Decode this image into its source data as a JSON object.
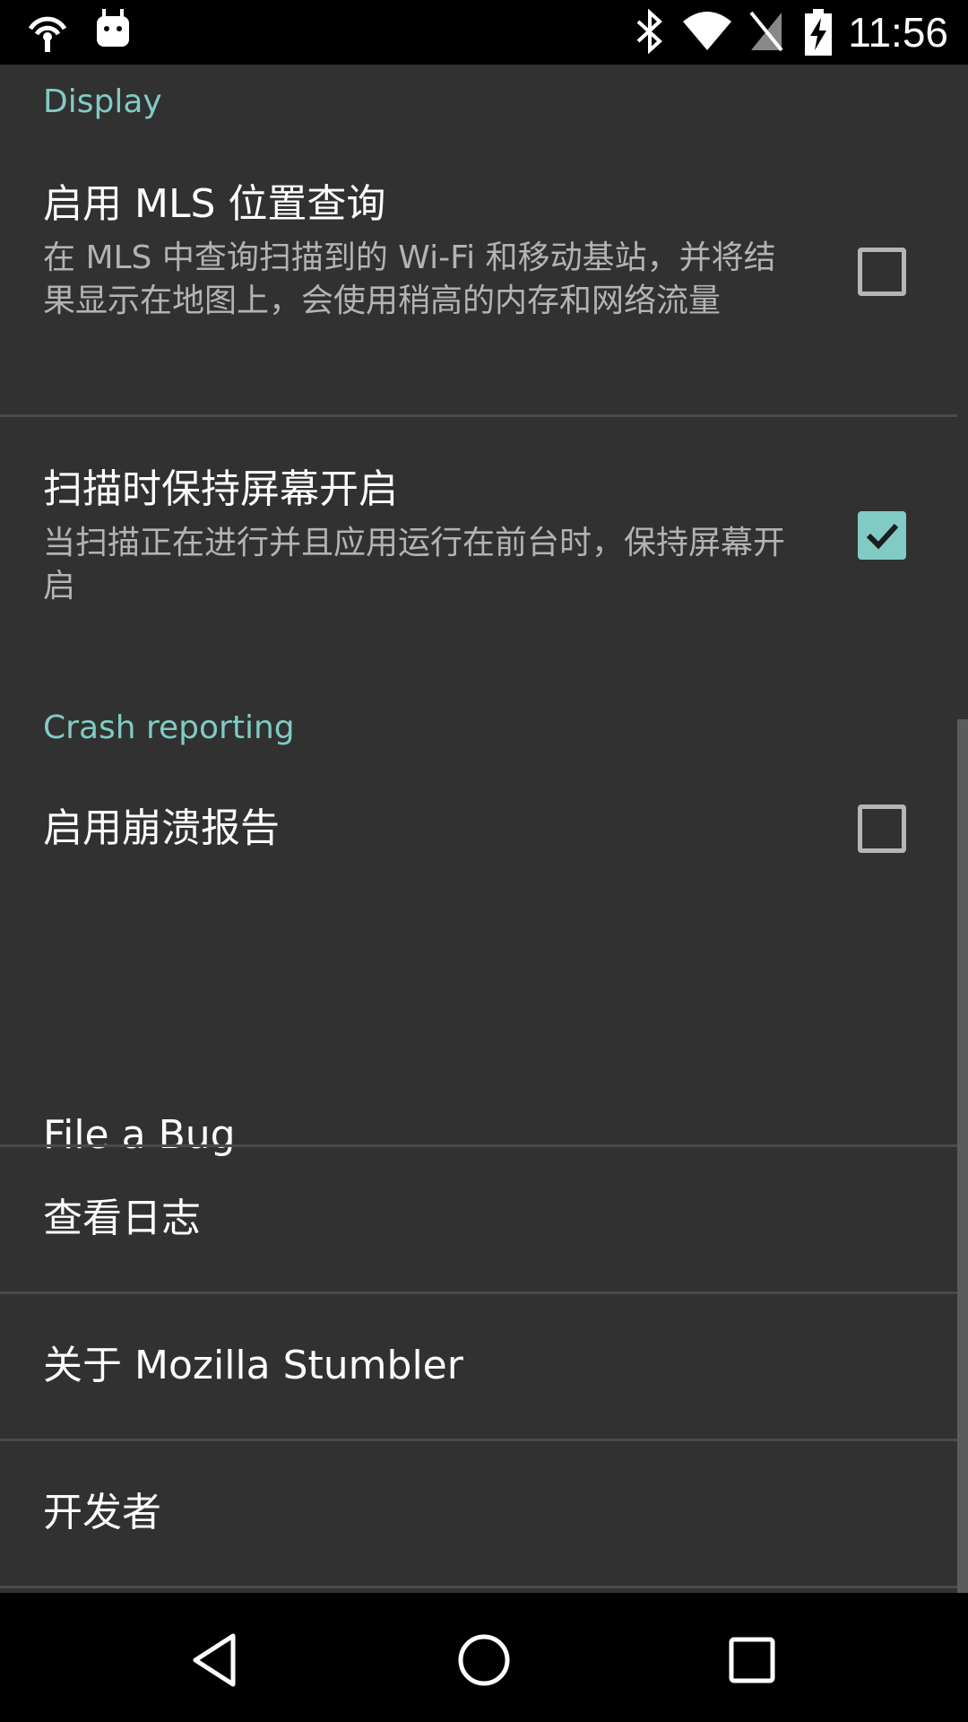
{
  "status_bar": {
    "time": "11:56",
    "left_icons": [
      "wifi-hotspot-icon",
      "android-icon"
    ],
    "right_icons": [
      "bluetooth-icon",
      "wifi-icon",
      "no-sim-icon",
      "battery-charging-icon"
    ]
  },
  "settings": {
    "display_category": "Display",
    "mls_lookup": {
      "title": "启用 MLS 位置查询",
      "summary": "在 MLS 中查询扫描到的 Wi-Fi 和移动基站，并将结果显示在地图上，会使用稍高的内存和网络流量",
      "checked": false
    },
    "keep_screen_on": {
      "title": "扫描时保持屏幕开启",
      "summary": "当扫描正在进行并且应用运行在前台时，保持屏幕开启",
      "checked": true
    },
    "crash_category": "Crash reporting",
    "crash_reporting": {
      "title": "启用崩溃报告",
      "checked": false
    },
    "file_bug": "File a Bug",
    "view_log": "查看日志",
    "about": "关于 Mozilla Stumbler",
    "developer": "开发者"
  },
  "nav_bar": {
    "back": "back-icon",
    "home": "home-icon",
    "recents": "recents-icon"
  },
  "colors": {
    "accent": "#80cbc4",
    "background": "#313131",
    "bars": "#000000"
  }
}
